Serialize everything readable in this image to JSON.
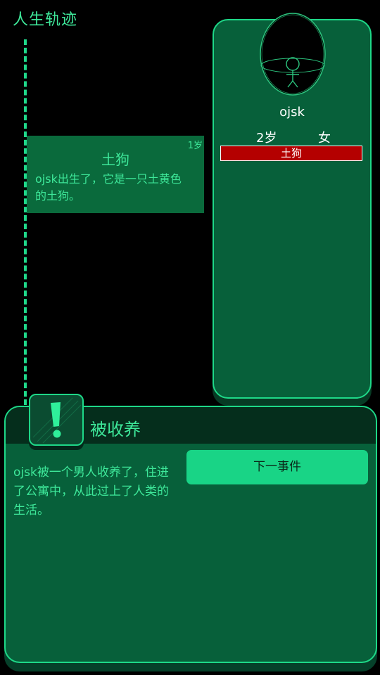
{
  "timeline": {
    "title": "人生轨迹"
  },
  "event_card": {
    "age_tag": "1岁",
    "title": "土狗",
    "description": "ojsk出生了，它是一只土黄色的土狗。"
  },
  "profile": {
    "name": "ojsk",
    "age": "2岁",
    "gender": "女",
    "breed": "土狗",
    "breed_color": "#b40000"
  },
  "event_panel": {
    "title": "被收养",
    "description": "ojsk被一个男人收养了，住进了公寓中，从此过上了人类的生活。",
    "next_button_label": "下一事件",
    "icon": "exclamation-icon"
  },
  "colors": {
    "accent": "#1ed888",
    "panel": "#07603a",
    "text": "#3ee89a"
  }
}
